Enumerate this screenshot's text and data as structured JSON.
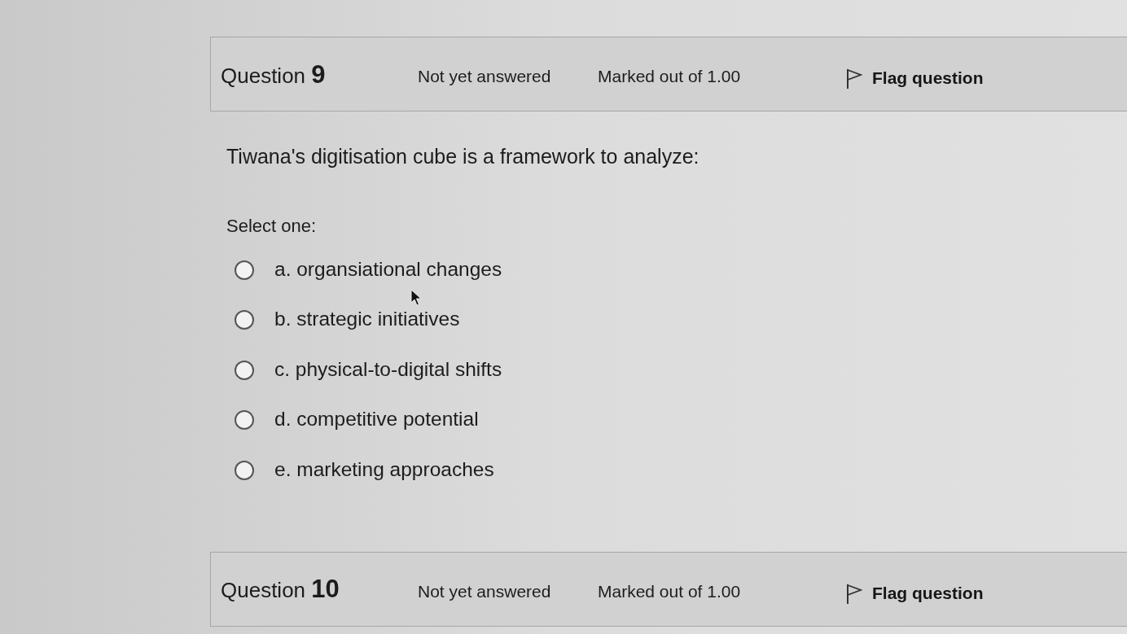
{
  "questions": [
    {
      "title": "Question **9**",
      "state": "Not yet answered",
      "marks": "Marked out of 1.00",
      "flag": {
        "label": "Flag question",
        "flagged": false
      },
      "text": "Tiwana's digitisation cube is a framework to analyze:",
      "prompt": "Select one:",
      "options": [
        {
          "label": "a. organsiational changes",
          "selected": false
        },
        {
          "label": "b. strategic initiatives",
          "selected": false
        },
        {
          "label": "c. physical-to-digital shifts",
          "selected": false
        },
        {
          "label": "d. competitive potential",
          "selected": false
        },
        {
          "label": "e. marketing approaches",
          "selected": false
        }
      ]
    },
    {
      "title": "Question **10**",
      "state": "Not yet answered",
      "marks": "Marked out of 1.00",
      "flag": {
        "label": "Flag question",
        "flagged": false
      }
    }
  ]
}
